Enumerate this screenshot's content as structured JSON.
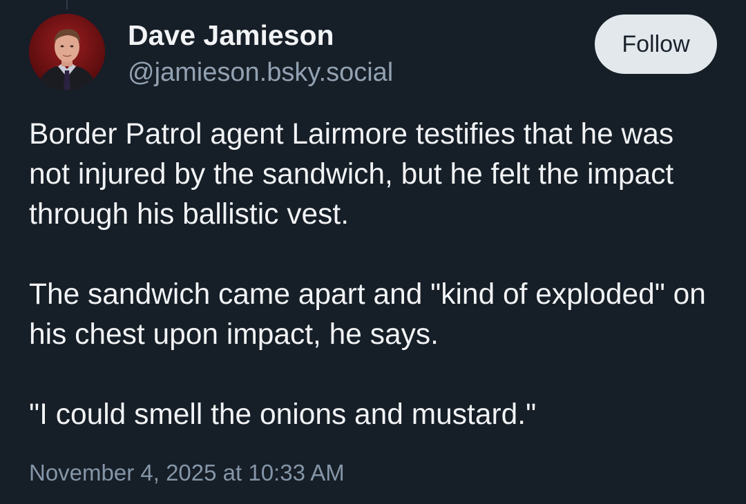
{
  "post": {
    "author": {
      "display_name": "Dave Jamieson",
      "handle": "@jamieson.bsky.social",
      "avatar_icon": "person-portrait"
    },
    "follow_label": "Follow",
    "paragraphs": [
      "Border Patrol agent Lairmore testifies that he was not injured by the sandwich, but he felt the impact through his ballistic vest.",
      "The sandwich came apart and \"kind of exploded\" on his chest upon impact, he says.",
      "\"I could smell the onions and mustard.\""
    ],
    "timestamp": "November 4, 2025 at 10:33 AM"
  },
  "colors": {
    "background": "#161e27",
    "text": "#f1f3f5",
    "muted_text": "#93a2b2",
    "follow_button_bg": "#e3e8ed"
  }
}
